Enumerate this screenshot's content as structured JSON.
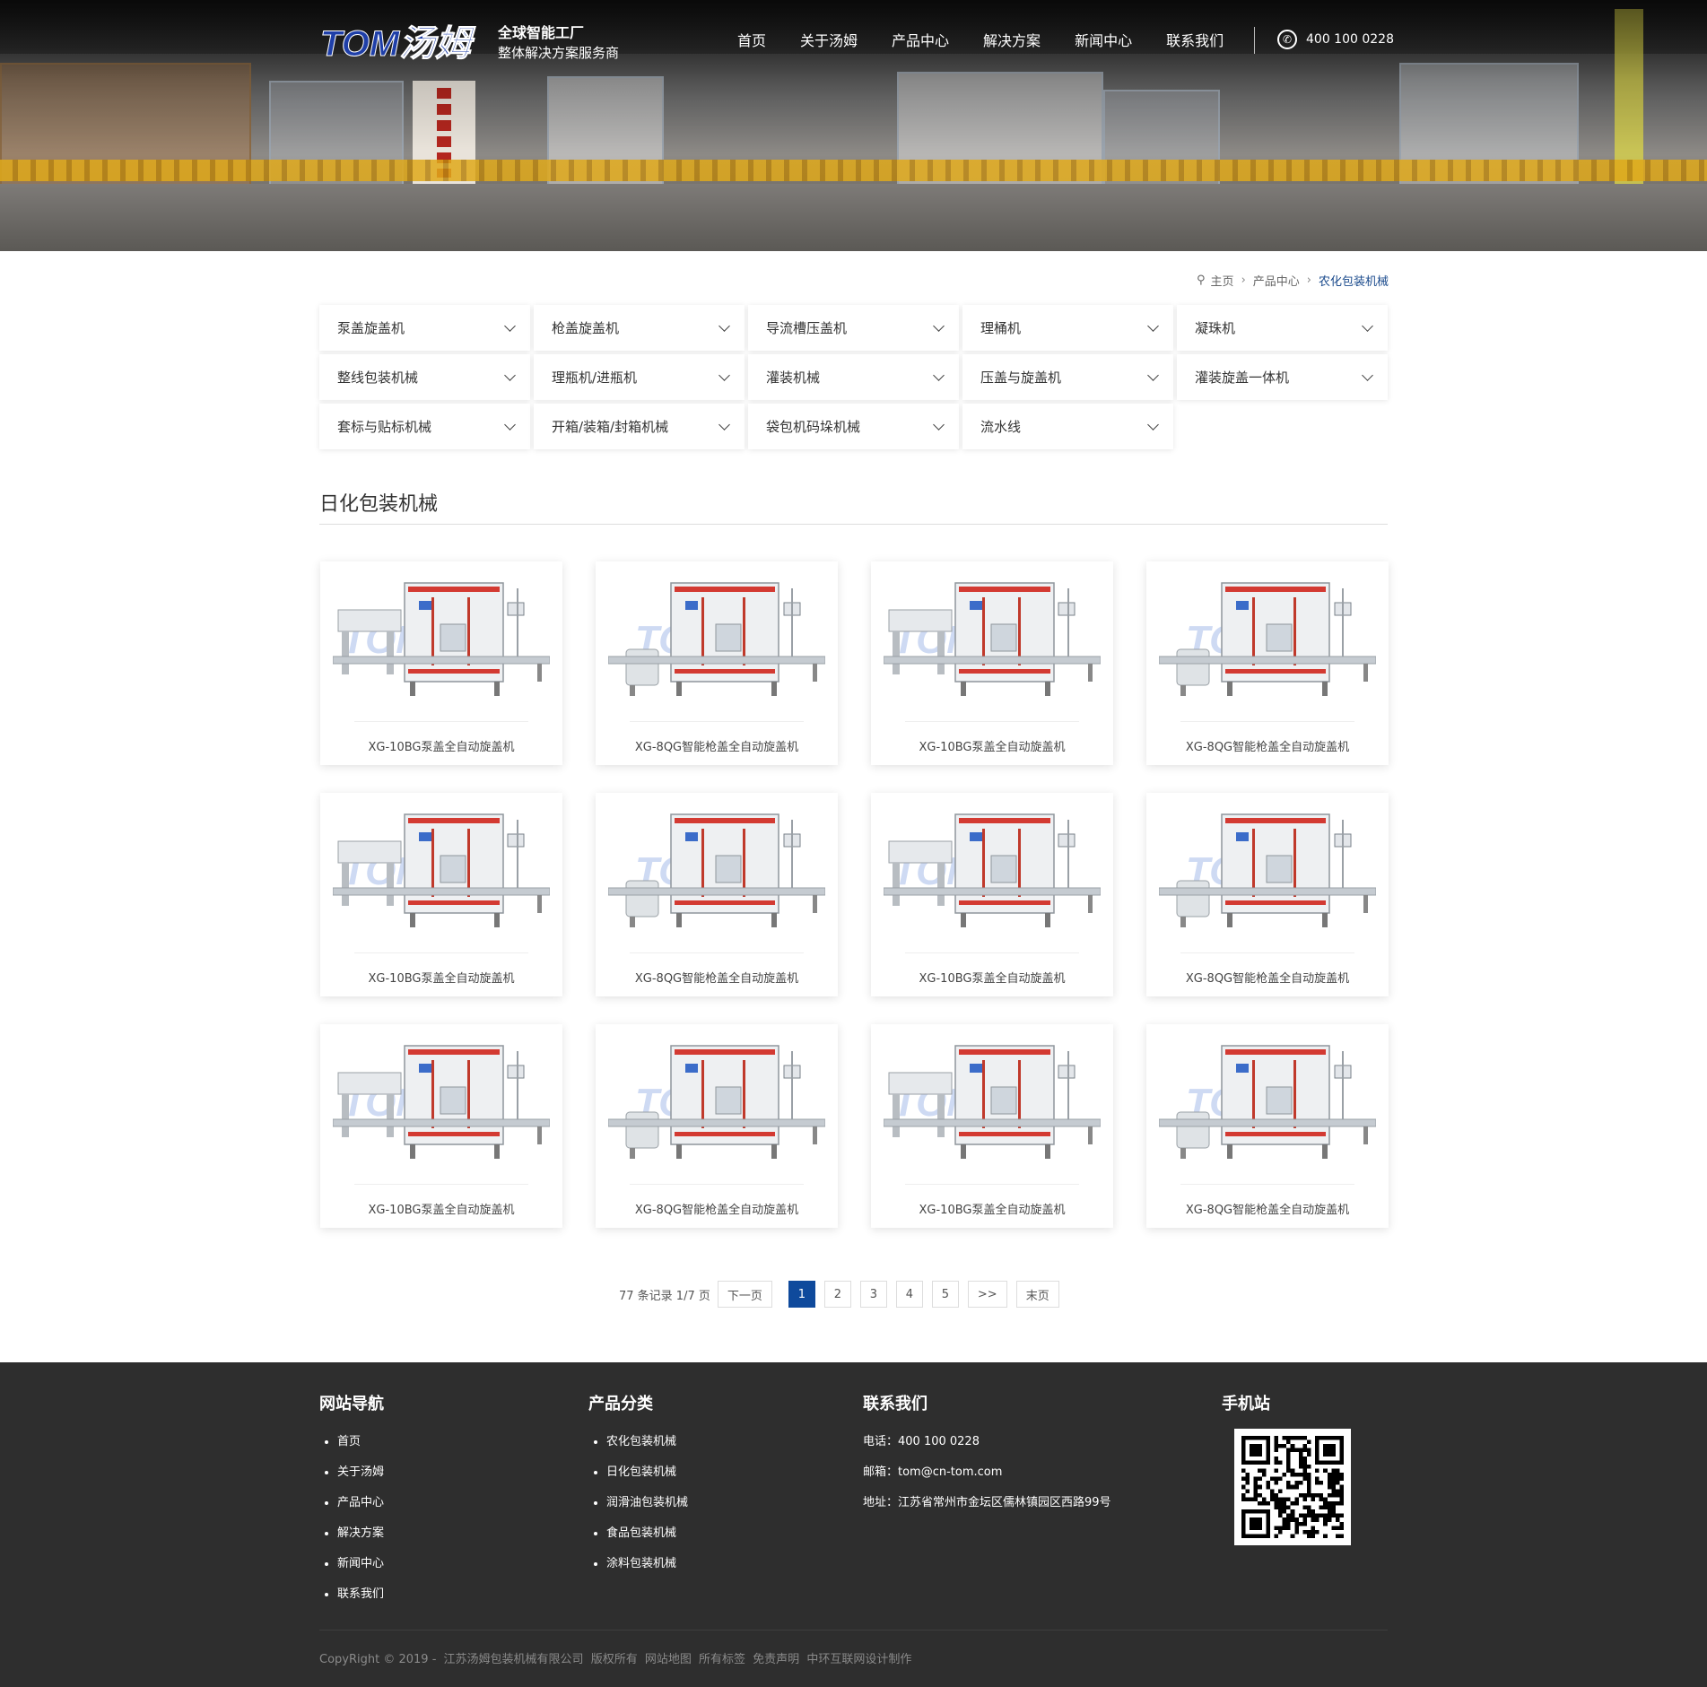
{
  "header": {
    "logo_text": "TOM汤姆",
    "tagline_line1": "全球智能工厂",
    "tagline_line2": "整体解决方案服务商",
    "nav": [
      "首页",
      "关于汤姆",
      "产品中心",
      "解决方案",
      "新闻中心",
      "联系我们"
    ],
    "phone": "400 100 0228",
    "icons": {
      "phone": "phone-icon"
    }
  },
  "breadcrumb": {
    "items": [
      "主页",
      "产品中心",
      "农化包装机械"
    ],
    "icon": "location-pin-icon"
  },
  "categories": [
    "泵盖旋盖机",
    "枪盖旋盖机",
    "导流槽压盖机",
    "理桶机",
    "凝珠机",
    "整线包装机械",
    "理瓶机/进瓶机",
    "灌装机械",
    "压盖与旋盖机",
    "灌装旋盖一体机",
    "套标与贴标机械",
    "开箱/装箱/封箱机械",
    "袋包机码垛机械",
    "流水线"
  ],
  "section": {
    "title": "日化包装机械"
  },
  "products": [
    {
      "name": "XG-10BG泵盖全自动旋盖机",
      "variant": "a"
    },
    {
      "name": "XG-8QG智能枪盖全自动旋盖机",
      "variant": "b"
    },
    {
      "name": "XG-10BG泵盖全自动旋盖机",
      "variant": "a"
    },
    {
      "name": "XG-8QG智能枪盖全自动旋盖机",
      "variant": "b"
    },
    {
      "name": "XG-10BG泵盖全自动旋盖机",
      "variant": "a"
    },
    {
      "name": "XG-8QG智能枪盖全自动旋盖机",
      "variant": "b"
    },
    {
      "name": "XG-10BG泵盖全自动旋盖机",
      "variant": "a"
    },
    {
      "name": "XG-8QG智能枪盖全自动旋盖机",
      "variant": "b"
    },
    {
      "name": "XG-10BG泵盖全自动旋盖机",
      "variant": "a"
    },
    {
      "name": "XG-8QG智能枪盖全自动旋盖机",
      "variant": "b"
    },
    {
      "name": "XG-10BG泵盖全自动旋盖机",
      "variant": "a"
    },
    {
      "name": "XG-8QG智能枪盖全自动旋盖机",
      "variant": "b"
    }
  ],
  "pagination": {
    "info": "77 条记录 1/7 页",
    "next": "下一页",
    "pages": [
      "1",
      "2",
      "3",
      "4",
      "5"
    ],
    "current": "1",
    "more": ">>",
    "last": "末页"
  },
  "footer": {
    "nav_title": "网站导航",
    "nav_items": [
      "首页",
      "关于汤姆",
      "产品中心",
      "解决方案",
      "新闻中心",
      "联系我们"
    ],
    "cat_title": "产品分类",
    "cat_items": [
      "农化包装机械",
      "日化包装机械",
      "润滑油包装机械",
      "食品包装机械",
      "涂料包装机械"
    ],
    "contact_title": "联系我们",
    "contact": {
      "phone": "电话：400 100 0228",
      "email": "邮箱：tom@cn-tom.com",
      "address": "地址：江苏省常州市金坛区儒林镇园区西路99号"
    },
    "mobile_title": "手机站",
    "copyright": {
      "text": "CopyRight © 2019 -",
      "company": "江苏汤姆包装机械有限公司",
      "rights": "版权所有",
      "sitemap": "网站地图",
      "tags": "所有标签",
      "disclaimer": "免责声明",
      "maker": "中环互联网设计制作"
    }
  },
  "colors": {
    "accent": "#0f4a9c",
    "footer_bg": "#2e2e2e",
    "logo_blue": "#1f3fa8"
  }
}
